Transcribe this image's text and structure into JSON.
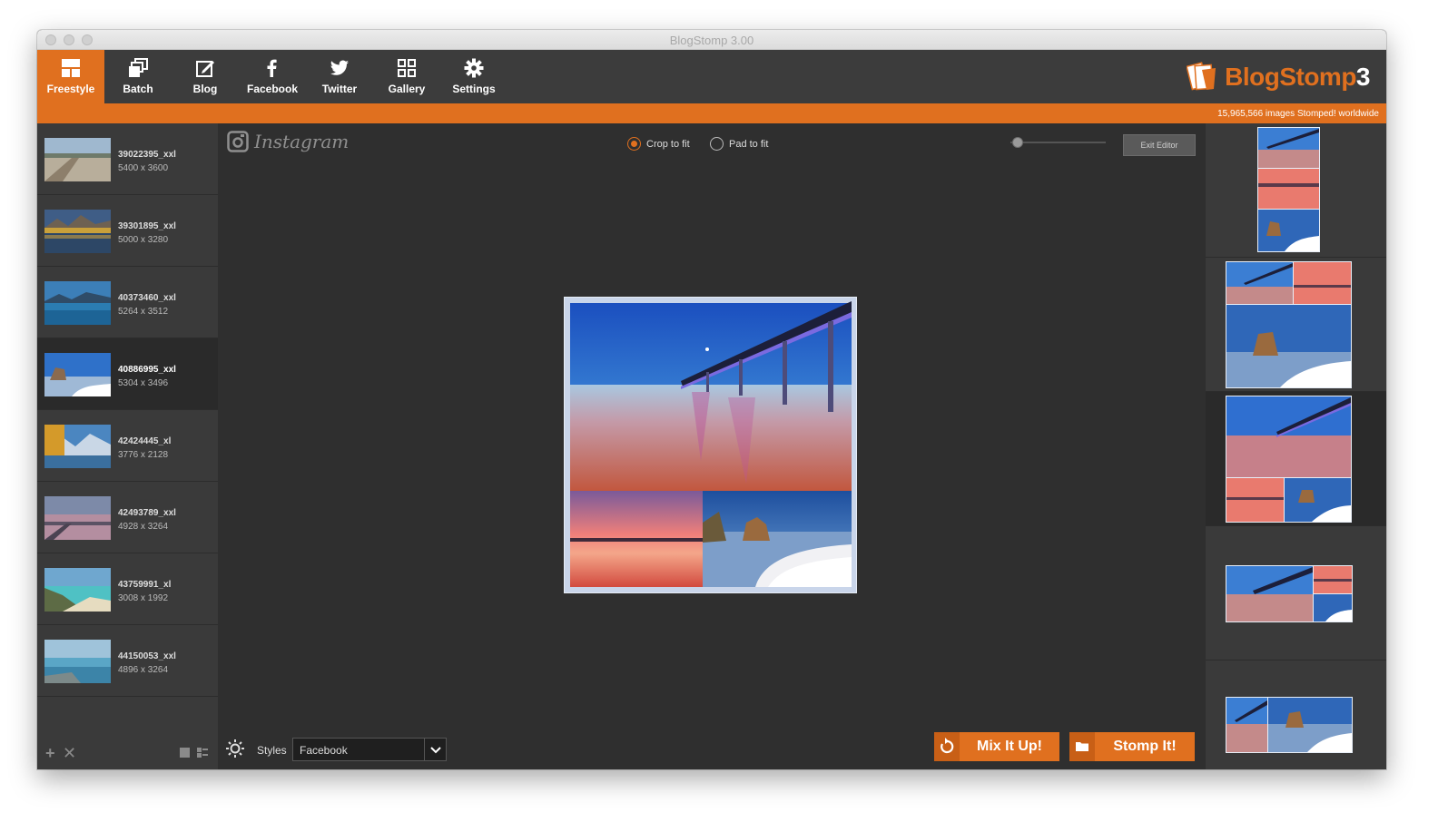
{
  "window": {
    "title": "BlogStomp 3.00"
  },
  "toolbar": {
    "tabs": [
      {
        "label": "Freestyle",
        "icon": "freestyle-icon",
        "active": true
      },
      {
        "label": "Batch",
        "icon": "batch-icon",
        "active": false
      },
      {
        "label": "Blog",
        "icon": "blog-edit-icon",
        "active": false
      },
      {
        "label": "Facebook",
        "icon": "facebook-icon",
        "active": false
      },
      {
        "label": "Twitter",
        "icon": "twitter-icon",
        "active": false
      },
      {
        "label": "Gallery",
        "icon": "gallery-grid-icon",
        "active": false
      },
      {
        "label": "Settings",
        "icon": "gear-icon",
        "active": false
      }
    ],
    "logo_text": "BlogStomp",
    "logo_suffix": "3"
  },
  "status": {
    "text": "15,965,566 images Stomped! worldwide"
  },
  "images": [
    {
      "name": "39022395_xxl",
      "dims": "5400 x 3600"
    },
    {
      "name": "39301895_xxl",
      "dims": "5000 x 3280"
    },
    {
      "name": "40373460_xxl",
      "dims": "5264 x 3512"
    },
    {
      "name": "40886995_xxl",
      "dims": "5304 x 3496",
      "selected": true
    },
    {
      "name": "42424445_xl",
      "dims": "3776 x 2128"
    },
    {
      "name": "42493789_xxl",
      "dims": "4928 x 3264"
    },
    {
      "name": "43759991_xl",
      "dims": "3008 x 1992"
    },
    {
      "name": "44150053_xxl",
      "dims": "4896 x 3264"
    }
  ],
  "editor": {
    "preset_name": "Instagram",
    "crop_label": "Crop to fit",
    "pad_label": "Pad to fit",
    "fit_mode": "crop",
    "exit_label": "Exit Editor"
  },
  "bottom": {
    "styles_label": "Styles",
    "styles_value": "Facebook",
    "mix_label": "Mix It Up!",
    "stomp_label": "Stomp It!"
  },
  "colors": {
    "accent": "#e0701f",
    "panel": "#3a3a3a",
    "canvas": "#2f2f2f"
  }
}
